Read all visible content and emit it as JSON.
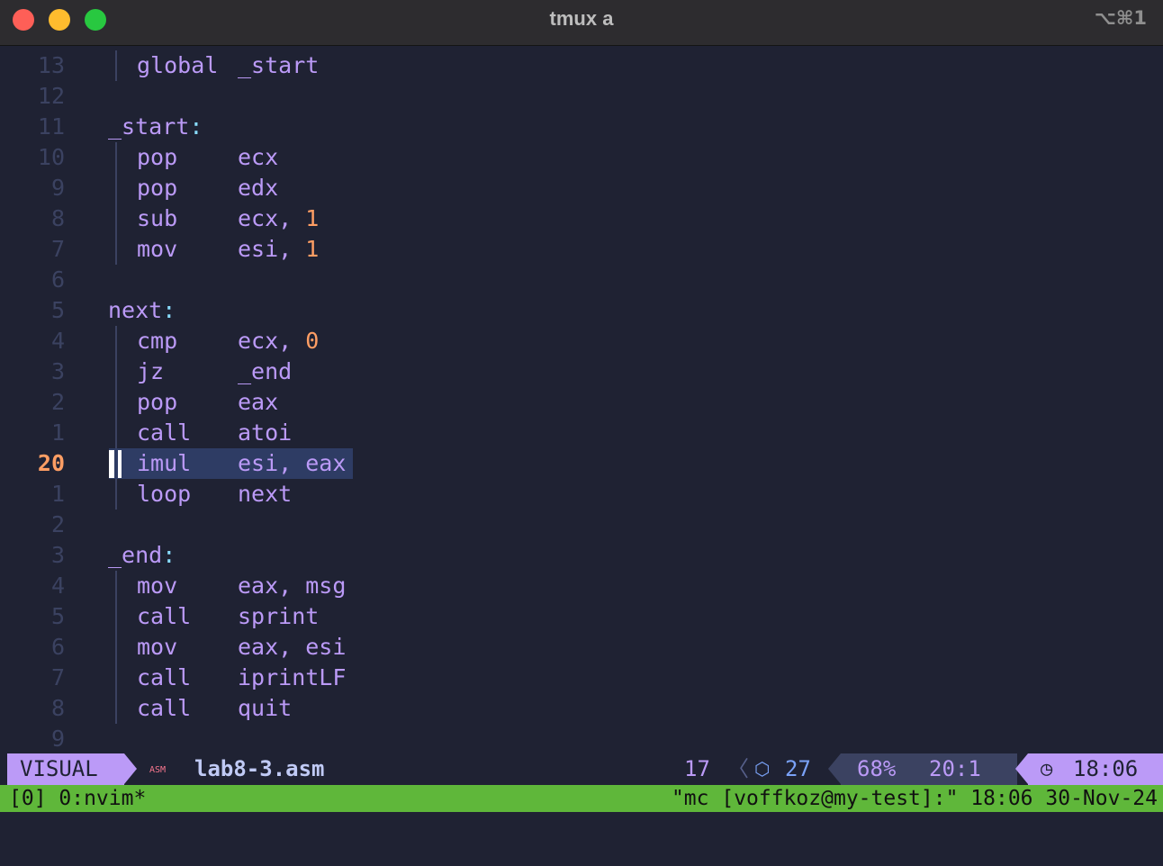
{
  "window": {
    "title": "tmux a",
    "shortcut": "⌥⌘1"
  },
  "editor": {
    "lines": [
      {
        "num": "13",
        "kind": "instr",
        "op": "global",
        "args": "_start"
      },
      {
        "num": "12",
        "kind": "blank"
      },
      {
        "num": "11",
        "kind": "label",
        "text": "_start",
        "colon": ":"
      },
      {
        "num": "10",
        "kind": "instr",
        "op": "pop",
        "args": "ecx"
      },
      {
        "num": "9",
        "kind": "instr",
        "op": "pop",
        "args": "edx"
      },
      {
        "num": "8",
        "kind": "instr",
        "op": "sub",
        "args": "ecx, ",
        "number": "1"
      },
      {
        "num": "7",
        "kind": "instr",
        "op": "mov",
        "args": "esi, ",
        "number": "1"
      },
      {
        "num": "6",
        "kind": "blank"
      },
      {
        "num": "5",
        "kind": "label",
        "text": "next",
        "colon": ":"
      },
      {
        "num": "4",
        "kind": "instr",
        "op": "cmp",
        "args": "ecx, ",
        "number": "0"
      },
      {
        "num": "3",
        "kind": "instr",
        "op": "jz",
        "args": "_end"
      },
      {
        "num": "2",
        "kind": "instr",
        "op": "pop",
        "args": "eax"
      },
      {
        "num": "1",
        "kind": "instr",
        "op": "call",
        "args": "atoi"
      },
      {
        "num": "20",
        "kind": "instr",
        "op": "imul",
        "args": "esi, eax",
        "current": true
      },
      {
        "num": "1",
        "kind": "instr",
        "op": "loop",
        "args": "next"
      },
      {
        "num": "2",
        "kind": "blank"
      },
      {
        "num": "3",
        "kind": "label",
        "text": "_end",
        "colon": ":"
      },
      {
        "num": "4",
        "kind": "instr",
        "op": "mov",
        "args": "eax, msg"
      },
      {
        "num": "5",
        "kind": "instr",
        "op": "call",
        "args": "sprint"
      },
      {
        "num": "6",
        "kind": "instr",
        "op": "mov",
        "args": "eax, esi"
      },
      {
        "num": "7",
        "kind": "instr",
        "op": "call",
        "args": "iprintLF"
      },
      {
        "num": "8",
        "kind": "instr",
        "op": "call",
        "args": "quit"
      },
      {
        "num": "9",
        "kind": "blank"
      }
    ]
  },
  "statusline": {
    "mode": "VISUAL",
    "filetype_icon": "ASM",
    "filename": "lab8-3.asm",
    "count_left": "17",
    "separator": "〈",
    "count_right": "27",
    "percent": "68%",
    "position": "20:1",
    "time": "18:06"
  },
  "tmux": {
    "left": "[0] 0:nvim*",
    "right": "\"mc [voffkoz@my-test]:\" 18:06 30-Nov-24"
  },
  "colors": {
    "background": "#1f2233",
    "keyword": "#bb9af7",
    "number": "#ff9e64",
    "selection": "#2e3c64",
    "tmux_bar": "#5fb73a"
  }
}
